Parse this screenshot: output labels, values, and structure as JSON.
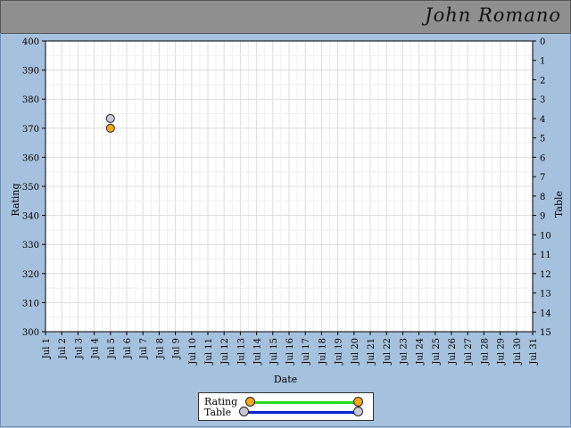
{
  "header": {
    "title": "John Romano"
  },
  "chart_data": {
    "type": "scatter",
    "xlabel": "Date",
    "ylabel_left": "Rating",
    "ylabel_right": "Table",
    "x_categories": [
      "Jul 1",
      "Jul 2",
      "Jul 3",
      "Jul 4",
      "Jul 5",
      "Jul 6",
      "Jul 7",
      "Jul 8",
      "Jul 9",
      "Jul 10",
      "Jul 11",
      "Jul 12",
      "Jul 13",
      "Jul 14",
      "Jul 15",
      "Jul 16",
      "Jul 17",
      "Jul 18",
      "Jul 19",
      "Jul 20",
      "Jul 21",
      "Jul 22",
      "Jul 23",
      "Jul 24",
      "Jul 25",
      "Jul 26",
      "Jul 27",
      "Jul 28",
      "Jul 29",
      "Jul 30",
      "Jul 31"
    ],
    "y_left": {
      "min": 300,
      "max": 400,
      "ticks": [
        300,
        310,
        320,
        330,
        340,
        350,
        360,
        370,
        380,
        390,
        400
      ]
    },
    "y_right": {
      "min": 0,
      "max": 15,
      "inverted": true,
      "ticks": [
        0,
        1,
        2,
        3,
        4,
        5,
        6,
        7,
        8,
        9,
        10,
        11,
        12,
        13,
        14,
        15
      ]
    },
    "grid": true,
    "legend_position": "bottom-center",
    "series": [
      {
        "name": "Rating",
        "axis": "left",
        "line_color": "#22dd22",
        "marker_color": "#f5a81c",
        "points": [
          {
            "x": "Jul 5",
            "y": 370
          }
        ]
      },
      {
        "name": "Table",
        "axis": "right",
        "line_color": "#0022cc",
        "marker_color": "#c8c8d8",
        "points": [
          {
            "x": "Jul 5",
            "y": 4
          }
        ]
      }
    ]
  }
}
